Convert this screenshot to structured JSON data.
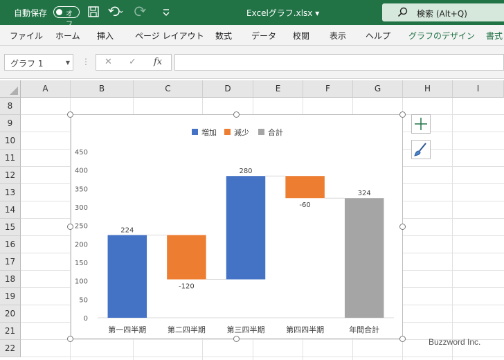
{
  "titlebar": {
    "autosave_label": "自動保存",
    "toggle_state": "オフ",
    "filename": "Excelグラフ.xlsx",
    "search_label": "検索 (Alt+Q)"
  },
  "ribbon": {
    "tabs": [
      {
        "label": "ファイル",
        "active": false
      },
      {
        "label": "ホーム",
        "active": false
      },
      {
        "label": "挿入",
        "active": false
      },
      {
        "label": "ページ レイアウト",
        "active": false
      },
      {
        "label": "数式",
        "active": false
      },
      {
        "label": "データ",
        "active": false
      },
      {
        "label": "校閲",
        "active": false
      },
      {
        "label": "表示",
        "active": false
      },
      {
        "label": "ヘルプ",
        "active": false
      },
      {
        "label": "グラフのデザイン",
        "active": true
      },
      {
        "label": "書式",
        "active": true
      }
    ]
  },
  "formula_bar": {
    "name_box": "グラフ 1",
    "fx": "fx",
    "formula_value": ""
  },
  "sheet": {
    "columns": [
      "A",
      "B",
      "C",
      "D",
      "E",
      "F",
      "G",
      "H",
      "I"
    ],
    "rows": [
      "8",
      "9",
      "10",
      "11",
      "12",
      "13",
      "14",
      "15",
      "16",
      "17",
      "18",
      "19",
      "20",
      "21",
      "22"
    ]
  },
  "chart_data": {
    "type": "bar",
    "subtype": "waterfall",
    "legend": [
      "増加",
      "減少",
      "合計"
    ],
    "legend_position": "top",
    "colors": {
      "increase": "#4472C4",
      "decrease": "#ED7D31",
      "total": "#A5A5A5"
    },
    "categories": [
      "第一四半期",
      "第二四半期",
      "第三四半期",
      "第四四半期",
      "年間合計"
    ],
    "values": [
      224,
      -120,
      280,
      -60,
      324
    ],
    "data_labels": [
      "224",
      "-120",
      "280",
      "-60",
      "324"
    ],
    "kinds": [
      "increase",
      "decrease",
      "increase",
      "decrease",
      "total"
    ],
    "yticks": [
      "0",
      "50",
      "100",
      "150",
      "200",
      "250",
      "300",
      "350",
      "400",
      "450"
    ],
    "ylim": [
      0,
      450
    ],
    "grid": false
  },
  "watermark": "Buzzword Inc."
}
